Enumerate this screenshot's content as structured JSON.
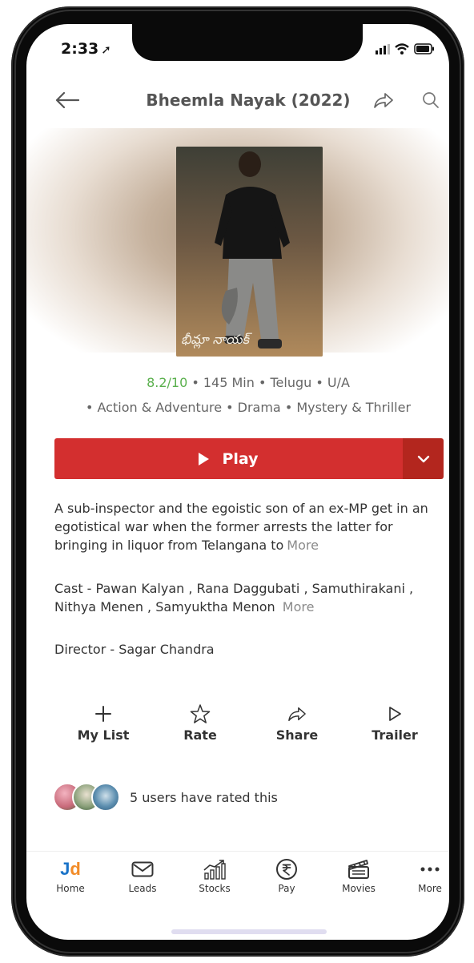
{
  "status": {
    "time": "2:33"
  },
  "header": {
    "title": "Bheemla Nayak (2022)"
  },
  "movie": {
    "poster_text": "భీమ్లా నాయక్",
    "rating": "8.2/10",
    "duration": "145 Min",
    "language": "Telugu",
    "certificate": "U/A",
    "genres": [
      "Action & Adventure",
      "Drama",
      "Mystery & Thriller"
    ],
    "play_label": "Play",
    "description": "A sub-inspector and the egoistic son of an ex-MP get in an egotistical war when the former arrests the latter for bringing in liquor from Telangana to",
    "more_label": "More",
    "cast": "Cast - Pawan Kalyan , Rana Daggubati , Samuthirakani , Nithya Menen , Samyuktha Menon",
    "director": "Director - Sagar Chandra"
  },
  "actions": [
    {
      "label": "My List",
      "icon": "plus-icon"
    },
    {
      "label": "Rate",
      "icon": "star-icon"
    },
    {
      "label": "Share",
      "icon": "share-icon"
    },
    {
      "label": "Trailer",
      "icon": "play-outline-icon"
    }
  ],
  "ratings": {
    "text": "5 users have rated this"
  },
  "nav": [
    {
      "label": "Home",
      "icon": "jd-logo-icon"
    },
    {
      "label": "Leads",
      "icon": "mail-icon"
    },
    {
      "label": "Stocks",
      "icon": "stocks-chart-icon"
    },
    {
      "label": "Pay",
      "icon": "rupee-icon"
    },
    {
      "label": "Movies",
      "icon": "clapperboard-icon"
    },
    {
      "label": "More",
      "icon": "more-dots-icon"
    }
  ],
  "colors": {
    "accent": "#d32f2f",
    "rating": "#5ab04d",
    "jd_blue": "#1a73c8",
    "jd_orange": "#f28c28"
  }
}
